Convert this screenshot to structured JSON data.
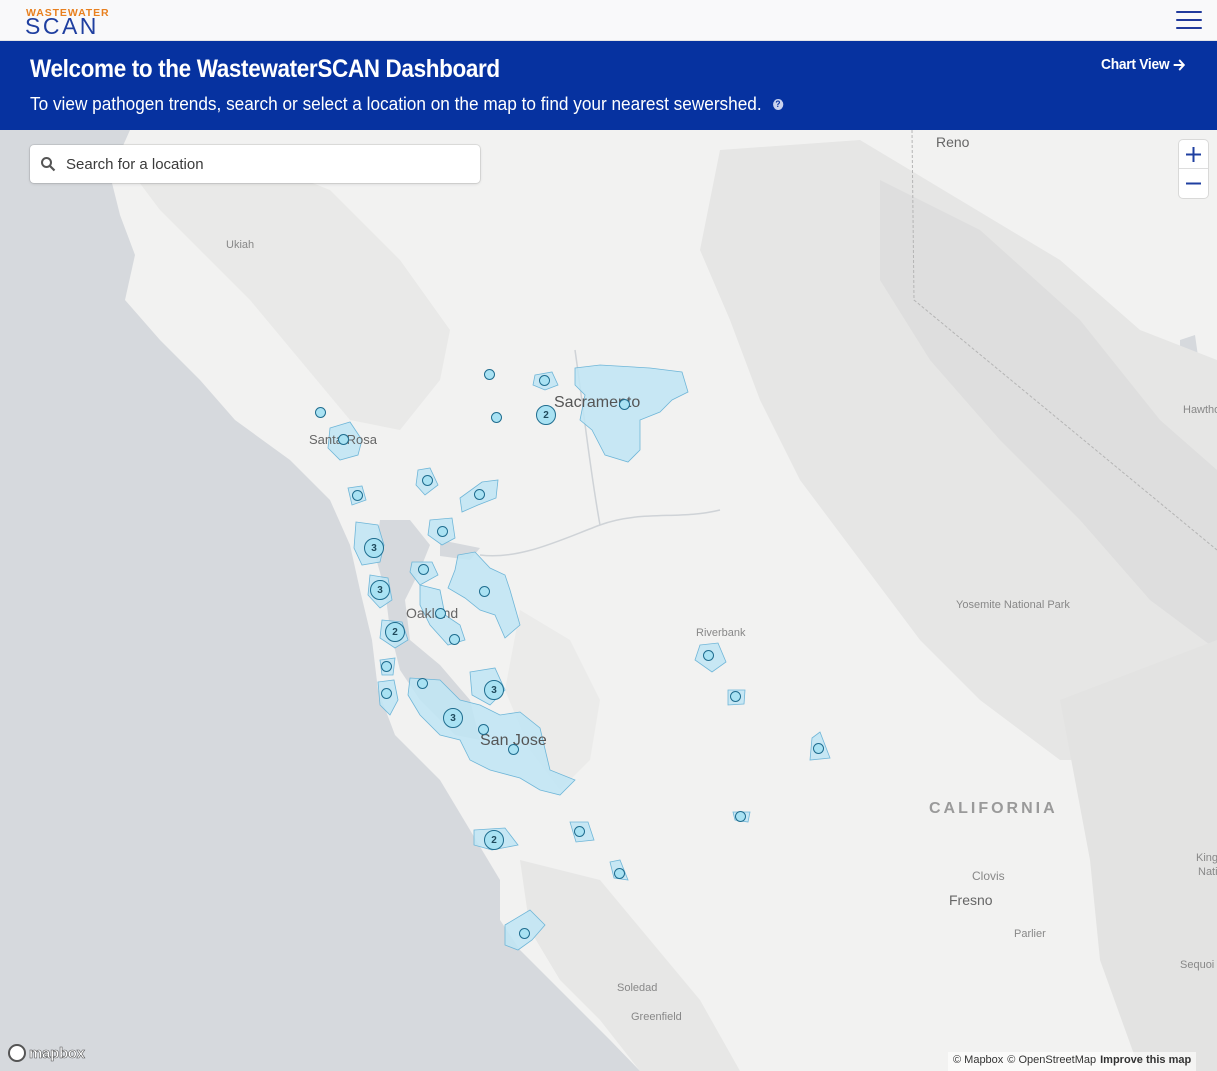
{
  "nav": {
    "logo_line1": "WASTEWATER",
    "logo_line2": "SCAN",
    "menu_icon": "hamburger-icon"
  },
  "banner": {
    "title": "Welcome to the WastewaterSCAN Dashboard",
    "subtitle": "To view pathogen trends, search or select a location on the map to find your nearest sewershed.",
    "help_icon": "question-circle-icon",
    "chart_view_label": "Chart View",
    "chart_view_icon": "arrow-right-icon"
  },
  "search": {
    "placeholder": "Search for a location",
    "icon": "search-icon"
  },
  "zoom": {
    "in_icon": "plus-icon",
    "out_icon": "minus-icon"
  },
  "map_labels": {
    "reno": "Reno",
    "ukiah": "Ukiah",
    "santa_rosa": "Santa Rosa",
    "sacramento": "Sacramento",
    "oakland": "Oakland",
    "san_jose": "San Jose",
    "riverbank": "Riverbank",
    "yosemite": "Yosemite National Park",
    "california": "CALIFORNIA",
    "clovis": "Clovis",
    "fresno": "Fresno",
    "parlier": "Parlier",
    "soledad": "Soledad",
    "greenfield": "Greenfield",
    "hawthorne": "Hawtho",
    "kings1": "King",
    "kings2": "Nati",
    "sequoia": "Sequoi"
  },
  "clusters": [
    {
      "count": "2"
    },
    {
      "count": "3"
    },
    {
      "count": "3"
    },
    {
      "count": "2"
    },
    {
      "count": "3"
    },
    {
      "count": "3"
    },
    {
      "count": "2"
    }
  ],
  "attribution": {
    "mapbox": "© Mapbox",
    "osm": "© OpenStreetMap",
    "improve": "Improve this map",
    "logo_text": "mapbox"
  },
  "colors": {
    "banner": "#0632a0",
    "nav_text": "#1f3fa0",
    "logo_accent": "#e8801f",
    "sewershed_fill": "#a9e2f3",
    "sewershed_stroke": "#1f6d8f",
    "water": "#d5d8dc",
    "land": "#f2f2f1"
  }
}
